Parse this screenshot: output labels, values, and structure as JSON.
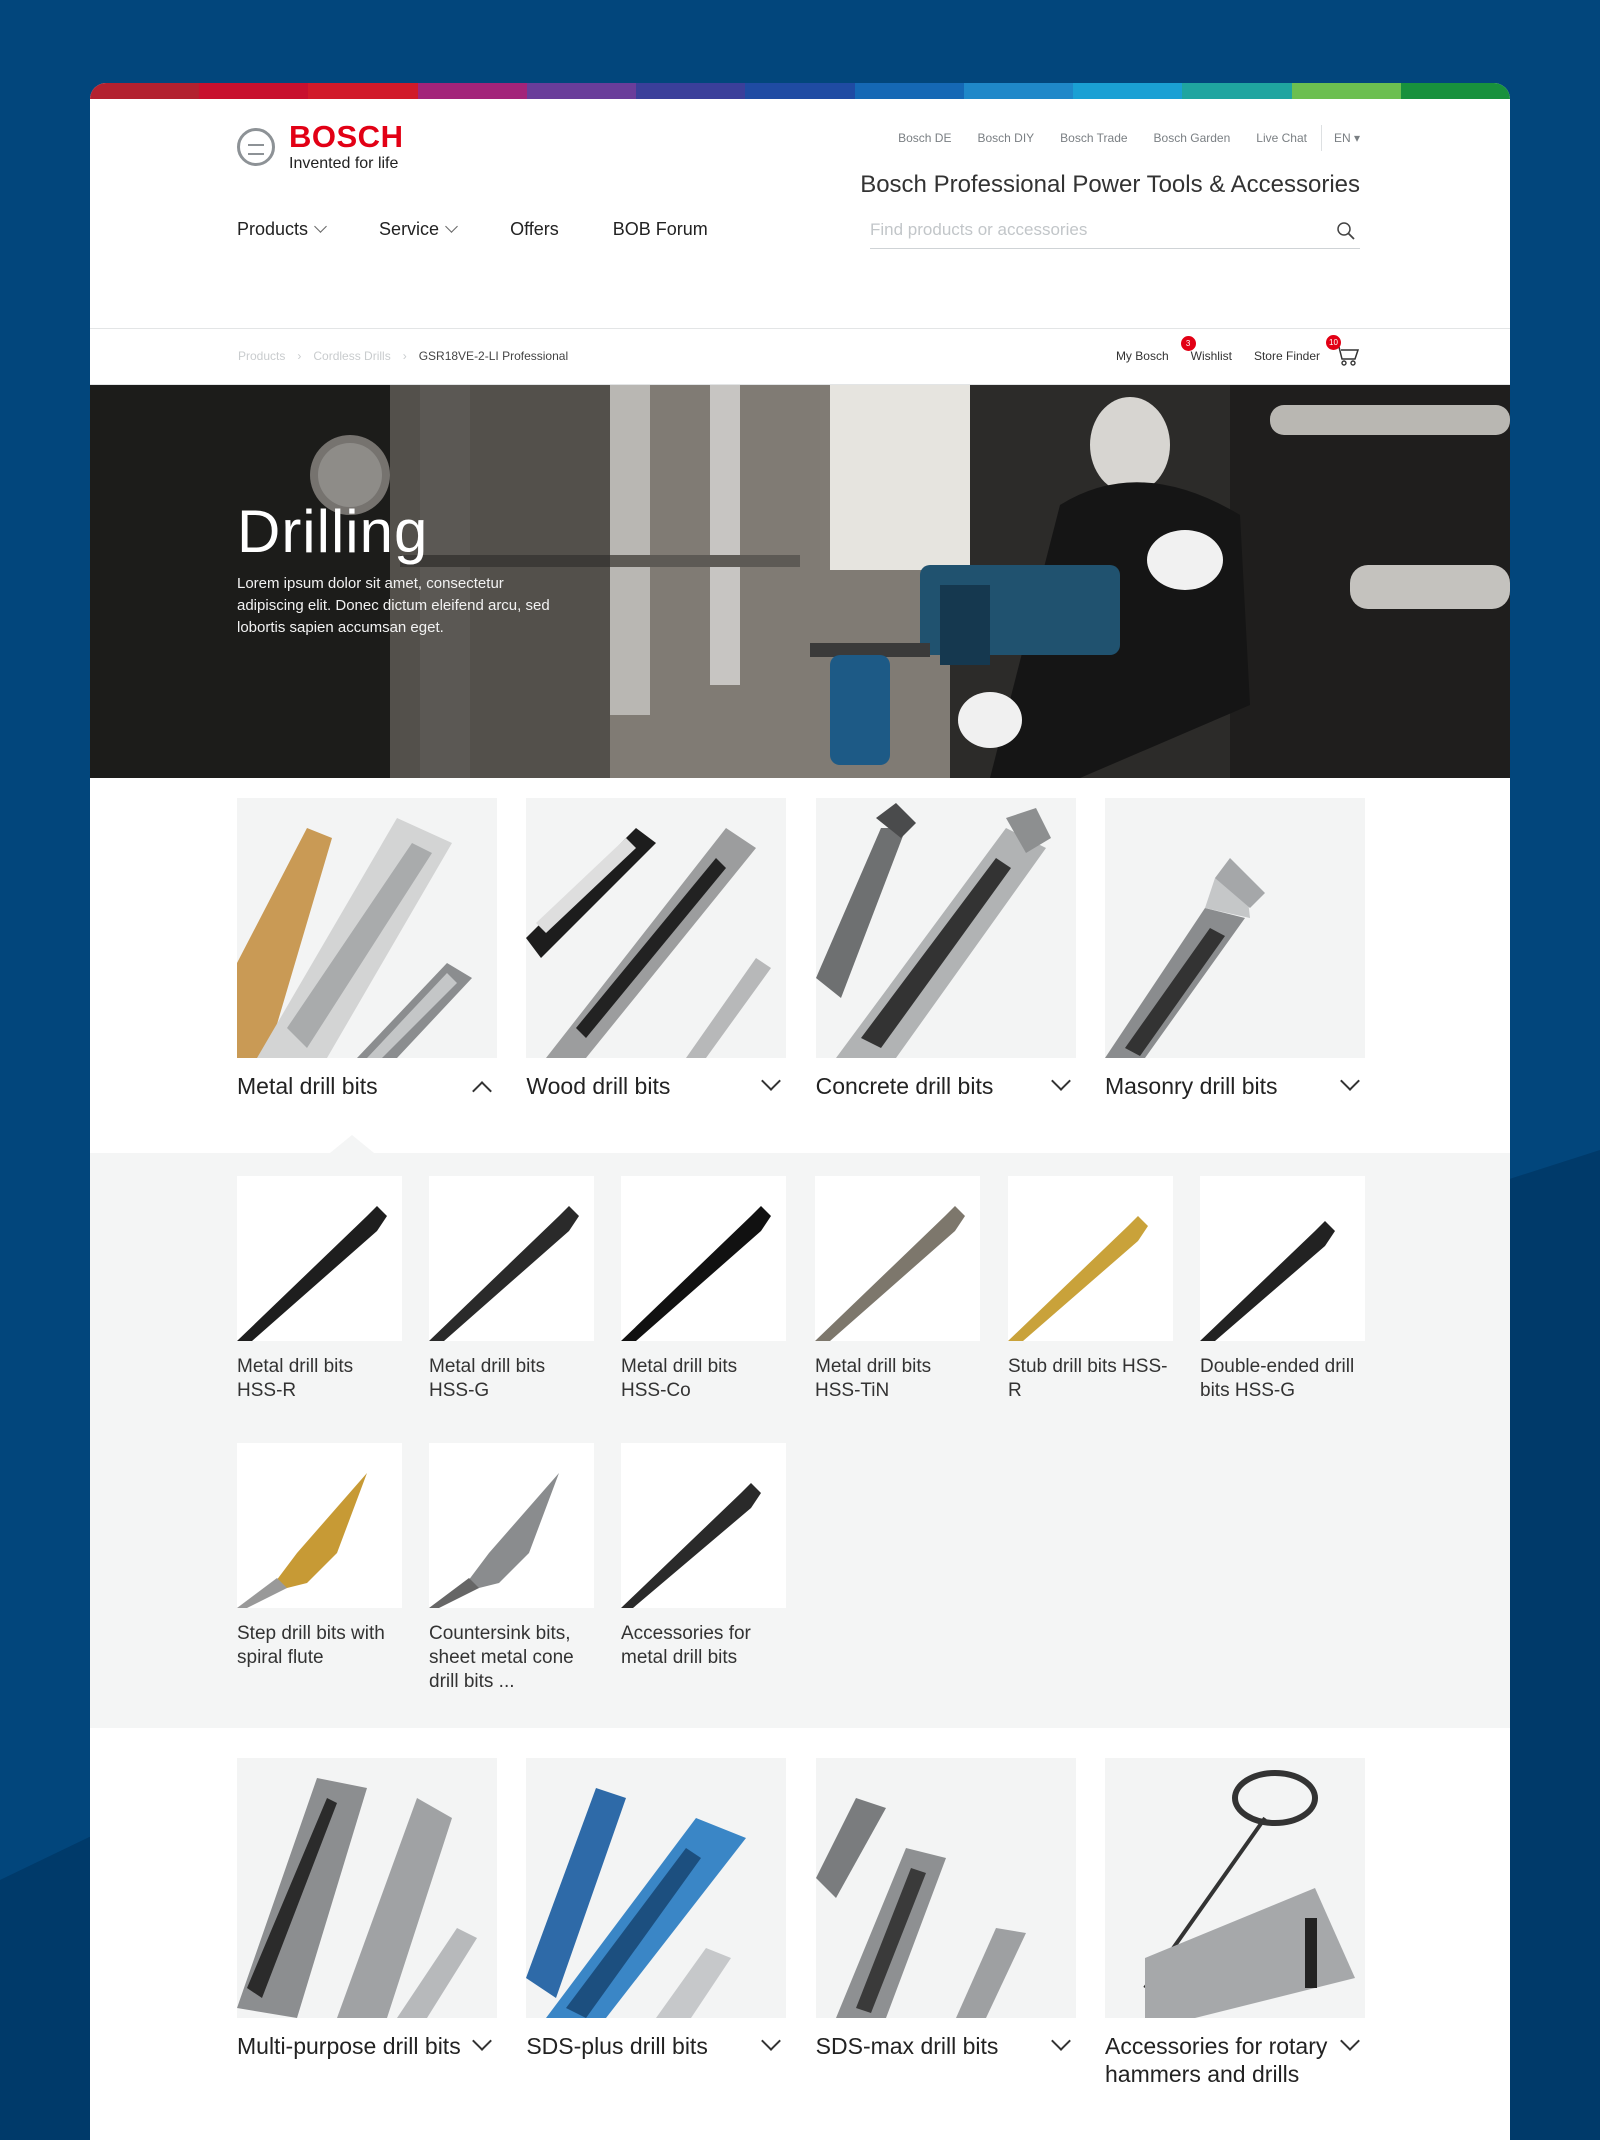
{
  "colors": {
    "brand_red": "#e20015",
    "page_bg": "#02467c"
  },
  "header": {
    "logo_brand": "BOSCH",
    "logo_tagline": "Invented for life",
    "top_links": [
      "Bosch DE",
      "Bosch DIY",
      "Bosch Trade",
      "Bosch Garden",
      "Live Chat"
    ],
    "language": "EN",
    "site_title": "Bosch Professional Power Tools & Accessories",
    "nav": [
      "Products",
      "Service",
      "Offers",
      "BOB Forum"
    ],
    "search_placeholder": "Find products or accessories"
  },
  "breadcrumb": [
    "Products",
    "Cordless Drills",
    "GSR18VE-2-LI Professional"
  ],
  "user_links": {
    "my_bosch": "My Bosch",
    "wishlist": "Wishlist",
    "wishlist_count": "3",
    "store_finder": "Store Finder",
    "cart_count": "10"
  },
  "hero": {
    "title": "Drilling",
    "text": "Lorem ipsum dolor sit amet, consectetur adipiscing elit. Donec dictum eleifend arcu, sed lobortis sapien accumsan eget."
  },
  "categories_top": [
    "Metal drill bits",
    "Wood drill bits",
    "Concrete drill bits",
    "Masonry drill bits"
  ],
  "subcategories": [
    "Metal drill bits HSS-R",
    "Metal drill bits HSS-G",
    "Metal drill bits HSS-Co",
    "Metal drill bits HSS-TiN",
    "Stub drill bits HSS-R",
    "Double-ended drill bits HSS-G",
    "Step drill bits with spiral flute",
    "Countersink bits, sheet metal cone drill bits ...",
    "Accessories for metal drill bits"
  ],
  "categories_bottom": [
    "Multi-purpose drill bits",
    "SDS-plus drill bits",
    "SDS-max drill bits",
    "Accessories for rotary hammers and drills"
  ]
}
